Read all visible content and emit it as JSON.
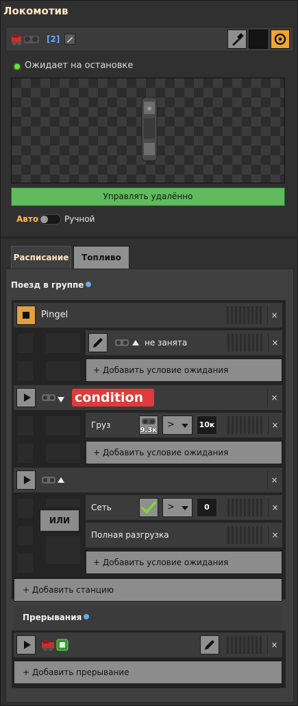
{
  "window": {
    "title": "Локомотив"
  },
  "toolbar": {
    "group_tag": "[2]",
    "icons": [
      "locomotive-icon",
      "edit-icon",
      "eyedropper-icon",
      "color-swatch",
      "gear-icon"
    ]
  },
  "status": {
    "text": "Ожидает на остановке",
    "color": "#6cdf3a"
  },
  "controls": {
    "remote_button": "Управлять удалённо",
    "mode_auto": "Авто",
    "mode_manual": "Ручной",
    "mode_is_auto": true
  },
  "tabs": [
    {
      "label": "Расписание",
      "active": true
    },
    {
      "label": "Топливо",
      "active": false
    }
  ],
  "schedule": {
    "group_label": "Поезд в группе",
    "stations": [
      {
        "name": "Pingel",
        "state": "stopped",
        "conditions": [
          {
            "type": "station",
            "text": "не занята"
          }
        ],
        "add_condition": "+ Добавить условие ожидания"
      },
      {
        "name": "",
        "state": "play",
        "direction": "down",
        "highlight_label": "condition",
        "conditions": [
          {
            "label": "Груз",
            "item_count": "9.3к",
            "operator": ">",
            "value": "10к"
          }
        ],
        "add_condition": "+ Добавить условие ожидания"
      },
      {
        "name": "",
        "state": "play",
        "direction": "up",
        "logic": "ИЛИ",
        "conditions": [
          {
            "label": "Сеть",
            "operator": ">",
            "value": "0"
          },
          {
            "label": "Полная разгрузка"
          }
        ],
        "add_condition": "+ Добавить условие ожидания"
      }
    ],
    "add_station": "+ Добавить станцию"
  },
  "interrupts": {
    "label": "Прерывания",
    "add_interrupt": "+ Добавить прерывание"
  }
}
